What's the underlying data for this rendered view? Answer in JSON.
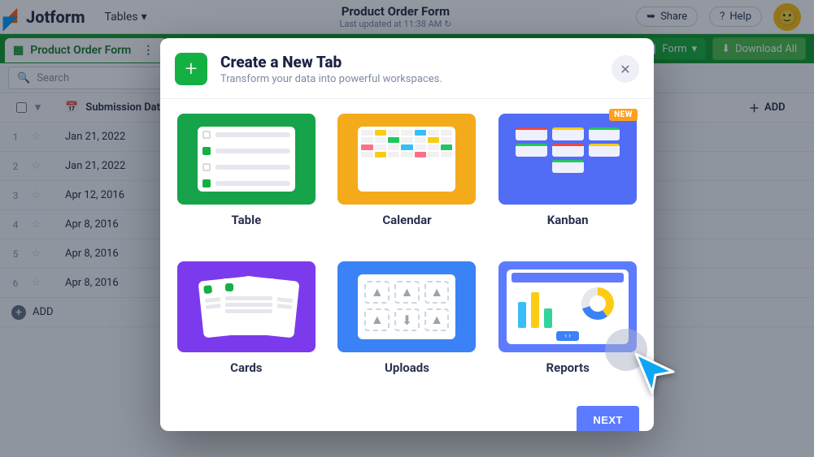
{
  "brand": "Jotform",
  "view_selector": "Tables",
  "header": {
    "title": "Product Order Form",
    "subtitle": "Last updated at 11:38 AM ↻",
    "share": "Share",
    "help": "Help"
  },
  "tab": {
    "name": "Product Order Form"
  },
  "actions": {
    "form_button": "Form",
    "download_all": "Download All"
  },
  "search_placeholder": "Search",
  "columns": {
    "date": "Submission Date",
    "add": "ADD"
  },
  "rows": [
    {
      "idx": "1",
      "date": "Jan 21, 2022"
    },
    {
      "idx": "2",
      "date": "Jan 21, 2022"
    },
    {
      "idx": "3",
      "date": "Apr 12, 2016"
    },
    {
      "idx": "4",
      "date": "Apr 8, 2016"
    },
    {
      "idx": "5",
      "date": "Apr 8, 2016"
    },
    {
      "idx": "6",
      "date": "Apr 8, 2016"
    }
  ],
  "add_row": "ADD",
  "modal": {
    "title": "Create a New Tab",
    "subtitle": "Transform your data into powerful workspaces.",
    "tiles": {
      "table": "Table",
      "calendar": "Calendar",
      "kanban": "Kanban",
      "cards": "Cards",
      "uploads": "Uploads",
      "reports": "Reports",
      "new_badge": "NEW"
    },
    "next": "NEXT"
  }
}
